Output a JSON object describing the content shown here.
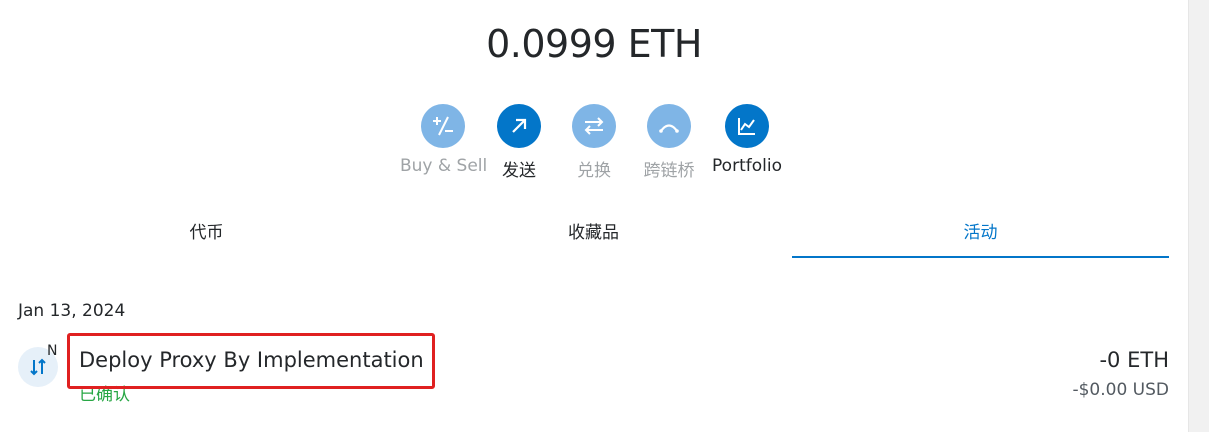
{
  "balance": {
    "text": "0.0999 ETH"
  },
  "actions": [
    {
      "label": "Buy & Sell",
      "icon": "plus-minus-icon",
      "enabled": false
    },
    {
      "label": "发送",
      "icon": "arrow-up-right-icon",
      "enabled": true
    },
    {
      "label": "兑换",
      "icon": "swap-icon",
      "enabled": false
    },
    {
      "label": "跨链桥",
      "icon": "bridge-icon",
      "enabled": false
    },
    {
      "label": "Portfolio",
      "icon": "chart-line-icon",
      "enabled": true
    }
  ],
  "tabs": [
    {
      "label": "代币",
      "active": false
    },
    {
      "label": "收藏品",
      "active": false
    },
    {
      "label": "活动",
      "active": true
    }
  ],
  "activity": {
    "date": "Jan 13, 2024",
    "transactions": [
      {
        "title": "Deploy Proxy By Implementation",
        "status": "已确认",
        "amount": "-0 ETH",
        "fiat": "-$0.00 USD",
        "network_badge": "N",
        "icon": "contract-interaction-icon"
      }
    ]
  },
  "colors": {
    "primary": "#0376c9",
    "primary_disabled": "#7fb5e6",
    "success": "#28a745",
    "highlight": "#e02020"
  }
}
